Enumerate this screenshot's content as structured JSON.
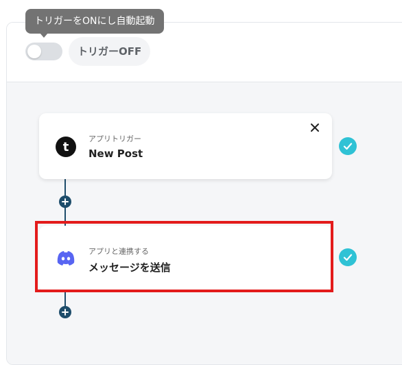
{
  "toggle": {
    "tooltip": "トリガーをONにし自動起動",
    "status": "トリガーOFF",
    "enabled": false
  },
  "colors": {
    "tooltip_bg": "#737373",
    "connector": "#1e4d6b",
    "check": "#2fc2d5",
    "highlight": "#e31b1b",
    "discord": "#5865f2"
  },
  "steps": [
    {
      "label": "アプリトリガー",
      "title": "New Post",
      "icon": "tumblr-icon",
      "completed": true
    },
    {
      "label": "アプリと連携する",
      "title": "メッセージを送信",
      "icon": "discord-icon",
      "completed": true
    }
  ]
}
